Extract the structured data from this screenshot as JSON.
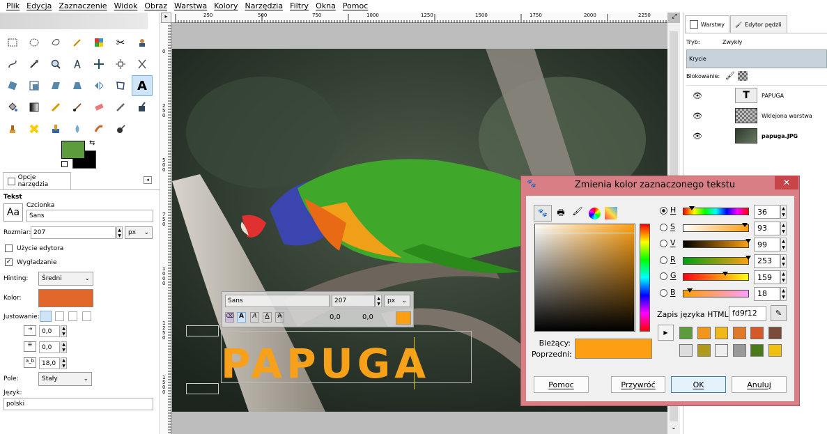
{
  "menu": [
    "Plik",
    "Edycja",
    "Zaznaczenie",
    "Widok",
    "Obraz",
    "Warstwa",
    "Kolory",
    "Narzędzia",
    "Filtry",
    "Okna",
    "Pomoc"
  ],
  "toolbox": {
    "tools": [
      "rect-select",
      "ellipse-select",
      "free-select",
      "fuzzy-select",
      "select-by-color",
      "scissors",
      "foreground-select",
      "paths",
      "color-picker",
      "zoom",
      "measure",
      "move",
      "align",
      "crop",
      "rotate",
      "scale",
      "shear",
      "perspective",
      "flip",
      "cage",
      "text",
      "bucket-fill",
      "blend",
      "pencil",
      "paintbrush",
      "eraser",
      "airbrush",
      "ink",
      "clone",
      "heal",
      "perspective-clone",
      "blur",
      "smudge",
      "dodge-burn"
    ],
    "active_tool": "text",
    "fg_color": "#5d9c3c",
    "bg_color": "#000000"
  },
  "tool_options": {
    "tab_label": "Opcje narzędzia",
    "section": "Tekst",
    "font_label": "Czcionka",
    "font_value": "Sans",
    "font_preview": "Aa",
    "size_label": "Rozmiar:",
    "size_value": "207",
    "size_unit": "px",
    "use_editor": "Użycie edytora",
    "antialias": "Wygładzanie",
    "hinting_label": "Hinting:",
    "hinting_value": "Średni",
    "color_label": "Kolor:",
    "color_value": "#e0662a",
    "justify_label": "Justowanie:",
    "indent": "0,0",
    "line_spacing": "0,0",
    "letter_spacing": "18,0",
    "box_label": "Pole:",
    "box_value": "Stały",
    "language_label": "Język:",
    "language_value": "polski"
  },
  "ruler": {
    "top": [
      "250",
      "500",
      "750",
      "1000",
      "1250",
      "1500",
      "1750",
      "2000",
      "2250"
    ],
    "left": [
      "0",
      "250",
      "500",
      "750",
      "1000",
      "1250",
      "1500"
    ]
  },
  "canvas": {
    "text_toolbar": {
      "font": "Sans",
      "size": "207",
      "unit": "px",
      "offset_x": "0,0",
      "offset_y": "0,0"
    },
    "text": "PAPUGA",
    "text_color": "#f7a01a"
  },
  "layers": {
    "tab_layers": "Warstwy",
    "tab_brush": "Edytor pędzli",
    "mode_label": "Tryb:",
    "mode_value": "Zwykły",
    "opacity_label": "Krycie",
    "lock_label": "Blokowanie:",
    "items": [
      {
        "name": "PAPUGA"
      },
      {
        "name": "Wklejona warstwa"
      },
      {
        "name": "papuga.JPG"
      }
    ]
  },
  "dialog": {
    "title": "Zmienia kolor zaznaczonego tekstu",
    "channels": [
      {
        "key": "H",
        "value": "36"
      },
      {
        "key": "S",
        "value": "93"
      },
      {
        "key": "V",
        "value": "99"
      },
      {
        "key": "R",
        "value": "253"
      },
      {
        "key": "G",
        "value": "159"
      },
      {
        "key": "B",
        "value": "18"
      }
    ],
    "html_label": "Zapis języka HTML:",
    "html_value": "fd9f12",
    "current_label": "Bieżący:",
    "previous_label": "Poprzedni:",
    "current_color": "#fd9f12",
    "history": [
      "#5d9c3c",
      "#f0961a",
      "#f2b81a",
      "#e07a2a",
      "#d5582a",
      "#7a4a3a",
      "#dddddd",
      "#b09a1a",
      "#eeeeee",
      "#999999",
      "#4a7a1a",
      "#f0c010"
    ],
    "buttons": {
      "help": "Pomoc",
      "reset": "Przywróć",
      "ok": "OK",
      "cancel": "Anuluj"
    }
  }
}
